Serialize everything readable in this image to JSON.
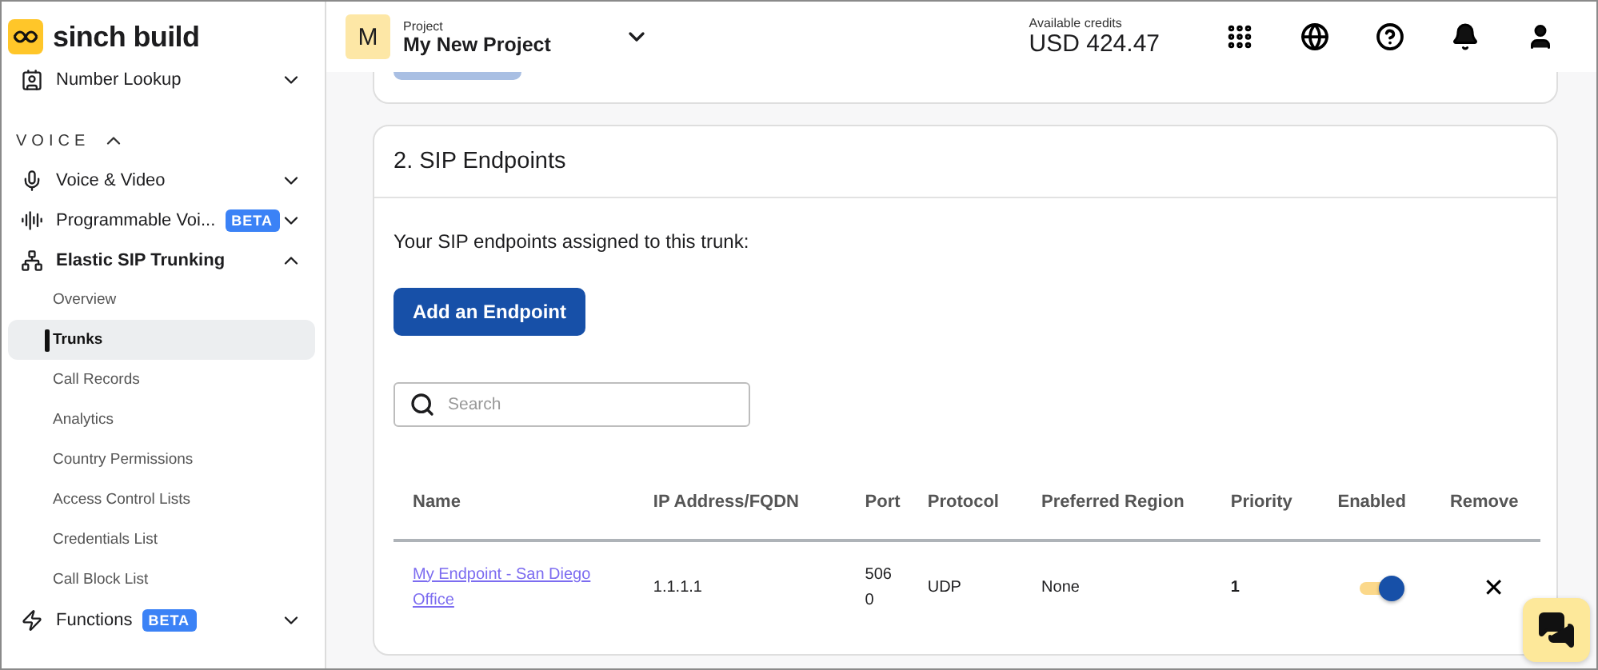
{
  "brand": {
    "name": "sinch build"
  },
  "sidebar": {
    "items": [
      {
        "kind": "item",
        "label": "Number Lookup",
        "expanded": false
      },
      {
        "kind": "section",
        "label": "VOICE",
        "expanded": true
      },
      {
        "kind": "item",
        "label": "Voice & Video",
        "expanded": false
      },
      {
        "kind": "item",
        "label": "Programmable Voi...",
        "badge": "BETA",
        "expanded": false
      },
      {
        "kind": "item",
        "label": "Elastic SIP Trunking",
        "expanded": true,
        "children": [
          {
            "label": "Overview",
            "selected": false
          },
          {
            "label": "Trunks",
            "selected": true
          },
          {
            "label": "Call Records",
            "selected": false
          },
          {
            "label": "Analytics",
            "selected": false
          },
          {
            "label": "Country Permissions",
            "selected": false
          },
          {
            "label": "Access Control Lists",
            "selected": false
          },
          {
            "label": "Credentials List",
            "selected": false
          },
          {
            "label": "Call Block List",
            "selected": false
          }
        ]
      },
      {
        "kind": "item",
        "label": "Functions",
        "badge": "BETA",
        "expanded": false
      }
    ]
  },
  "header": {
    "project": {
      "initial": "M",
      "label": "Project",
      "name": "My New Project"
    },
    "credits": {
      "label": "Available credits",
      "amount": "USD 424.47"
    }
  },
  "section": {
    "title": "2. SIP Endpoints",
    "intro": "Your SIP endpoints assigned to this trunk:",
    "add_button": "Add an Endpoint",
    "search": {
      "placeholder": "Search"
    },
    "table": {
      "columns": [
        "Name",
        "IP Address/FQDN",
        "Port",
        "Protocol",
        "Preferred Region",
        "Priority",
        "Enabled",
        "Remove"
      ],
      "rows": [
        {
          "name": "My Endpoint - San Diego Office",
          "ip": "1.1.1.1",
          "port": "5060",
          "protocol": "UDP",
          "region": "None",
          "priority": "1",
          "enabled": true,
          "remove": "✕"
        }
      ]
    }
  }
}
